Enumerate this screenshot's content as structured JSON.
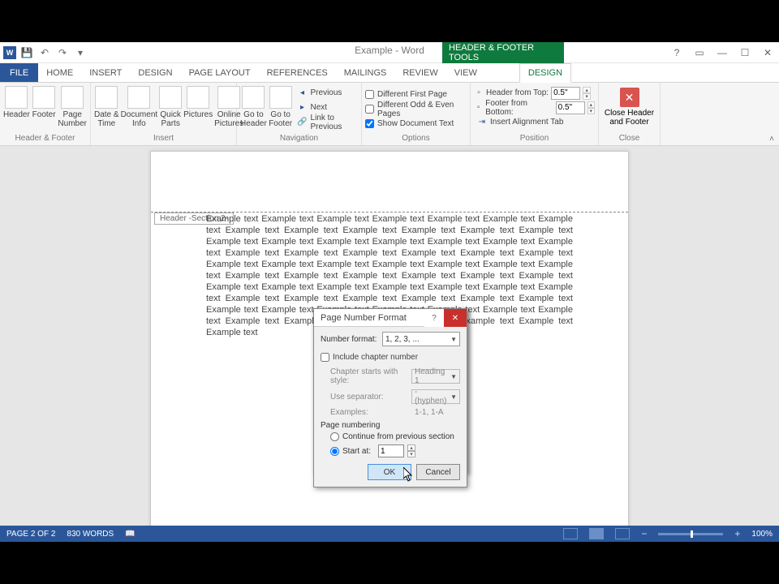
{
  "title": "Example - Word",
  "context_tools_label": "HEADER & FOOTER TOOLS",
  "tabs": {
    "file": "FILE",
    "home": "HOME",
    "insert": "INSERT",
    "design": "DESIGN",
    "page_layout": "PAGE LAYOUT",
    "references": "REFERENCES",
    "mailings": "MAILINGS",
    "review": "REVIEW",
    "view": "VIEW",
    "context_design": "DESIGN"
  },
  "ribbon": {
    "groups": {
      "header_footer": {
        "label": "Header & Footer",
        "header": "Header",
        "footer": "Footer",
        "page_number": "Page\nNumber"
      },
      "insert": {
        "label": "Insert",
        "date_time": "Date &\nTime",
        "doc_info": "Document\nInfo",
        "quick_parts": "Quick\nParts",
        "pictures": "Pictures",
        "online_pictures": "Online\nPictures"
      },
      "navigation": {
        "label": "Navigation",
        "goto_header": "Go to\nHeader",
        "goto_footer": "Go to\nFooter",
        "previous": "Previous",
        "next": "Next",
        "link_previous": "Link to Previous"
      },
      "options": {
        "label": "Options",
        "diff_first": "Different First Page",
        "diff_odd_even": "Different Odd & Even Pages",
        "show_doc": "Show Document Text"
      },
      "position": {
        "label": "Position",
        "header_top": "Header from Top:",
        "footer_bottom": "Footer from Bottom:",
        "header_val": "0.5\"",
        "footer_val": "0.5\"",
        "align_tab": "Insert Alignment Tab"
      },
      "close": {
        "label": "Close",
        "close_btn": "Close Header\nand Footer"
      }
    }
  },
  "document": {
    "header_tab": "Header -Section 2-",
    "body": "Example text Example text Example text Example text Example text Example text Example text Example text Example text Example text Example text Example text Example text Example text Example text Example text Example text Example text Example text Example text Example text Example text Example text Example text Example text Example text Example text Example text Example text Example text Example text Example text Example text Example text Example text Example text Example text Example text Example text Example text Example text Example text Example text Example text Example text Example text Example text Example text Example text Example text Example text Example text Example text Example text Example text Example text Example text Example text Example text Example text Example text Example text Example text Example text Example text Example text"
  },
  "dialog": {
    "title": "Page Number Format",
    "number_format_label": "Number format:",
    "number_format_value": "1, 2, 3, ...",
    "include_chapter": "Include chapter number",
    "chapter_style_label": "Chapter starts with style:",
    "chapter_style_value": "Heading 1",
    "use_separator_label": "Use separator:",
    "use_separator_value": "- (hyphen)",
    "examples_label": "Examples:",
    "examples_value": "1-1, 1-A",
    "page_numbering_label": "Page numbering",
    "continue_label": "Continue from previous section",
    "start_at_label": "Start at:",
    "start_at_value": "1",
    "ok": "OK",
    "cancel": "Cancel"
  },
  "status": {
    "page": "PAGE 2 OF 2",
    "words": "830 WORDS",
    "zoom": "100%"
  }
}
